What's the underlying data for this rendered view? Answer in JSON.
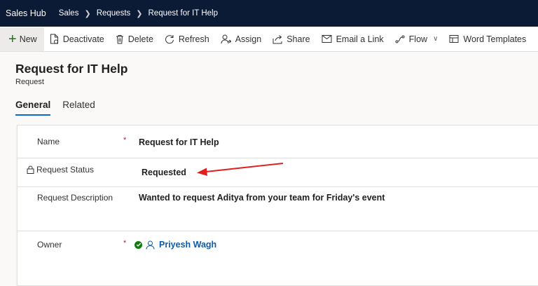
{
  "topbar": {
    "app_name": "Sales Hub",
    "breadcrumbs": [
      "Sales",
      "Requests",
      "Request for IT Help"
    ]
  },
  "commands": {
    "new": "New",
    "deactivate": "Deactivate",
    "delete": "Delete",
    "refresh": "Refresh",
    "assign": "Assign",
    "share": "Share",
    "email_link": "Email a Link",
    "flow": "Flow",
    "word_templates": "Word Templates"
  },
  "record": {
    "title": "Request for IT Help",
    "entity": "Request"
  },
  "tabs": [
    "General",
    "Related"
  ],
  "fields": {
    "name": {
      "label": "Name",
      "required": "*",
      "value": "Request for IT Help"
    },
    "status": {
      "label": "Request Status",
      "value": "Requested"
    },
    "description": {
      "label": "Request Description",
      "value": "Wanted to request Aditya from your team for Friday's event"
    },
    "owner": {
      "label": "Owner",
      "required": "*",
      "value": "Priyesh Wagh"
    }
  },
  "colors": {
    "topbar": "#0b1a35",
    "accent": "#0f6cbd",
    "link": "#0f5ba7",
    "required": "#a4262c",
    "annotation_arrow": "#e02020"
  }
}
